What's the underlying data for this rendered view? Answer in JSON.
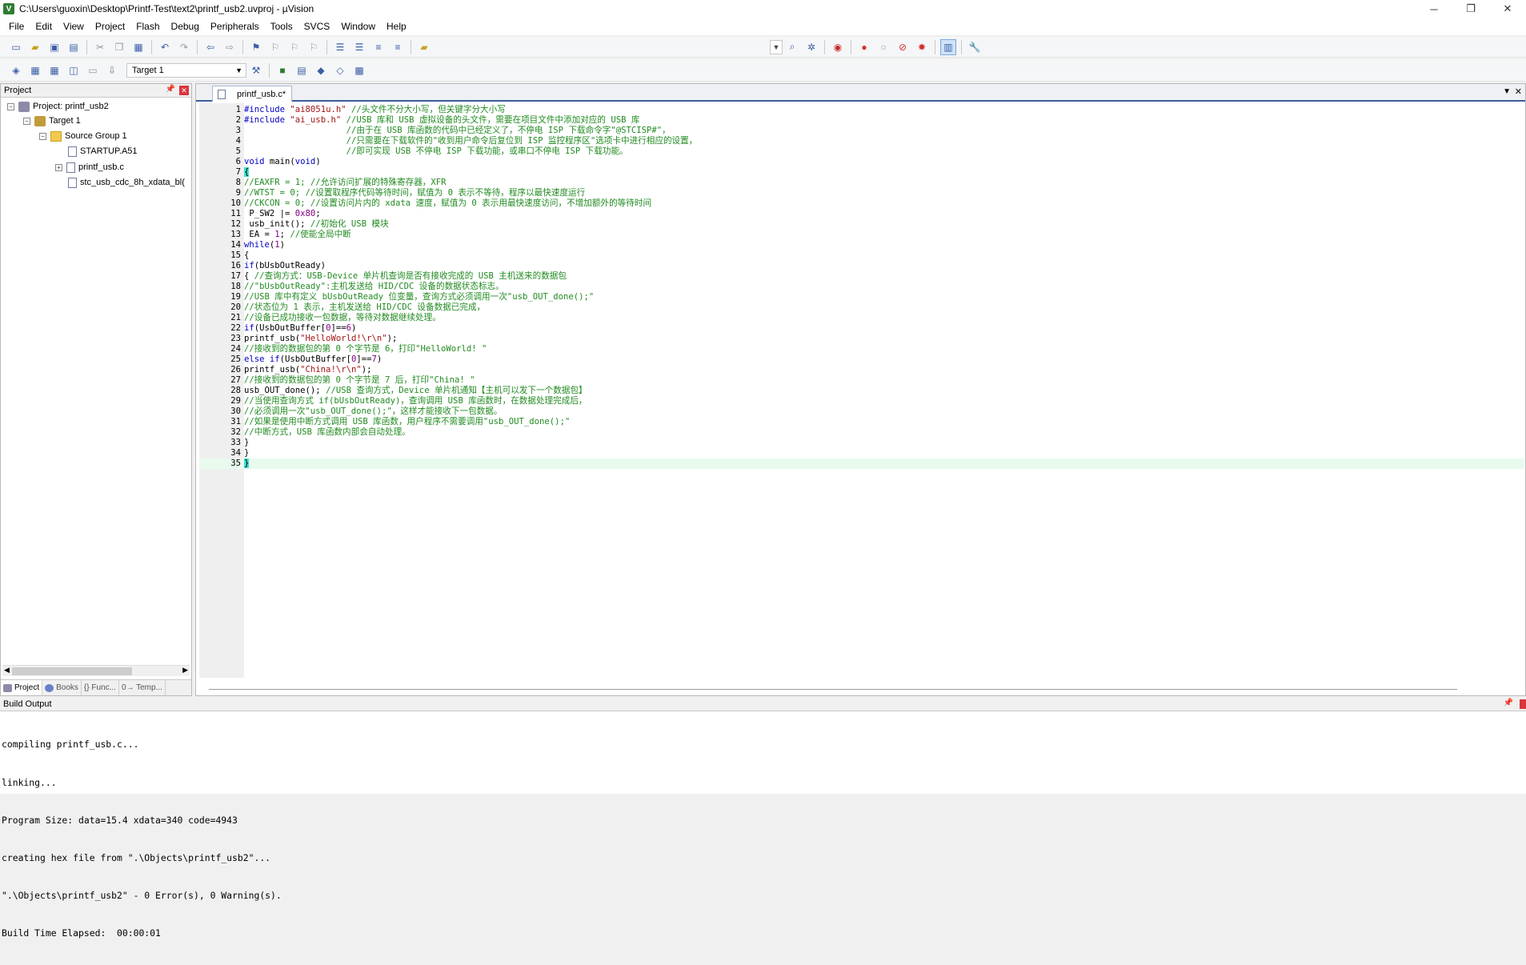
{
  "window": {
    "title": "C:\\Users\\guoxin\\Desktop\\Printf-Test\\text2\\printf_usb2.uvproj - µVision",
    "controls": [
      "─",
      "❐",
      "✕"
    ]
  },
  "menubar": [
    "File",
    "Edit",
    "View",
    "Project",
    "Flash",
    "Debug",
    "Peripherals",
    "Tools",
    "SVCS",
    "Window",
    "Help"
  ],
  "toolbar": {
    "target_select": "Target 1"
  },
  "project_panel": {
    "title": "Project",
    "tree": {
      "project": "Project: printf_usb2",
      "target": "Target 1",
      "group": "Source Group 1",
      "files": [
        "STARTUP.A51",
        "printf_usb.c",
        "stc_usb_cdc_8h_xdata_bl("
      ]
    },
    "tabs": [
      "Project",
      "Books",
      "{} Func...",
      "0→ Temp..."
    ]
  },
  "editor": {
    "tab_label": "printf_usb.c*",
    "current_line": 35,
    "lines": [
      {
        "n": "1",
        "t": "#include \"ai8051u.h\" //头文件不分大小写，但关键字分大小写"
      },
      {
        "n": "2",
        "t": "#include \"ai_usb.h\" //USB 库和 USB 虚拟设备的头文件，需要在项目文件中添加对应的 USB 库"
      },
      {
        "n": "3",
        "t": "                    //由于在 USB 库函数的代码中已经定义了，不停电 ISP 下载命令字\"@STCISP#\"，"
      },
      {
        "n": "4",
        "t": "                    //只需要在下载软件的\"收到用户命令后复位到 ISP 监控程序区\"选项卡中进行相应的设置，"
      },
      {
        "n": "5",
        "t": "                    //即可实现 USB 不停电 ISP 下载功能，或串口不停电 ISP 下载功能。"
      },
      {
        "n": "6",
        "t": "void main(void)"
      },
      {
        "n": "7",
        "t": "{"
      },
      {
        "n": "8",
        "t": "//EAXFR = 1; //允许访问扩展的特殊寄存器，XFR"
      },
      {
        "n": "9",
        "t": "//WTST = 0; //设置取程序代码等待时间，赋值为 0 表示不等待，程序以最快速度运行"
      },
      {
        "n": "10",
        "t": "//CKCON = 0; //设置访问片内的 xdata 速度，赋值为 0 表示用最快速度访问，不增加额外的等待时间"
      },
      {
        "n": "11",
        "t": " P_SW2 |= 0x80;"
      },
      {
        "n": "12",
        "t": " usb_init(); //初始化 USB 模块"
      },
      {
        "n": "13",
        "t": " EA = 1; //使能全局中断"
      },
      {
        "n": "14",
        "t": "while(1)"
      },
      {
        "n": "15",
        "t": "{"
      },
      {
        "n": "16",
        "t": "if(bUsbOutReady)"
      },
      {
        "n": "17",
        "t": "{ //查询方式：USB-Device 单片机查询是否有接收完成的 USB 主机送来的数据包"
      },
      {
        "n": "18",
        "t": "//\"bUsbOutReady\":主机发送给 HID/CDC 设备的数据状态标志。"
      },
      {
        "n": "19",
        "t": "//USB 库中有定义 bUsbOutReady 位变量，查询方式必须调用一次\"usb_OUT_done();\""
      },
      {
        "n": "20",
        "t": "//状态位为 1 表示，主机发送给 HID/CDC 设备数据已完成，"
      },
      {
        "n": "21",
        "t": "//设备已成功接收一包数据，等待对数据继续处理。"
      },
      {
        "n": "22",
        "t": "if(UsbOutBuffer[0]==6)"
      },
      {
        "n": "23",
        "t": "printf_usb(\"HelloWorld!\\r\\n\");"
      },
      {
        "n": "24",
        "t": "//接收到的数据包的第 0 个字节是 6，打印\"HelloWorld! \""
      },
      {
        "n": "25",
        "t": "else if(UsbOutBuffer[0]==7)"
      },
      {
        "n": "26",
        "t": "printf_usb(\"China!\\r\\n\");"
      },
      {
        "n": "27",
        "t": "//接收到的数据包的第 0 个字节是 7 后，打印\"China! \""
      },
      {
        "n": "28",
        "t": "usb_OUT_done(); //USB 查询方式，Device 单片机通知【主机可以发下一个数据包】"
      },
      {
        "n": "29",
        "t": "//当使用查询方式 if(bUsbOutReady)，查询调用 USB 库函数时，在数据处理完成后，"
      },
      {
        "n": "30",
        "t": "//必须调用一次\"usb_OUT_done();\"，这样才能接收下一包数据。"
      },
      {
        "n": "31",
        "t": "//如果是使用中断方式调用 USB 库函数，用户程序不需要调用\"usb_OUT_done();\""
      },
      {
        "n": "32",
        "t": "//中断方式，USB 库函数内部会自动处理。"
      },
      {
        "n": "33",
        "t": "}"
      },
      {
        "n": "34",
        "t": "}"
      },
      {
        "n": "35",
        "t": "}"
      }
    ]
  },
  "build_output": {
    "title": "Build Output",
    "lines": [
      "compiling printf_usb.c...",
      "linking...",
      "Program Size: data=15.4 xdata=340 code=4943",
      "creating hex file from \".\\Objects\\printf_usb2\"...",
      "\".\\Objects\\printf_usb2\" - 0 Error(s), 0 Warning(s).",
      "Build Time Elapsed:  00:00:01"
    ]
  }
}
